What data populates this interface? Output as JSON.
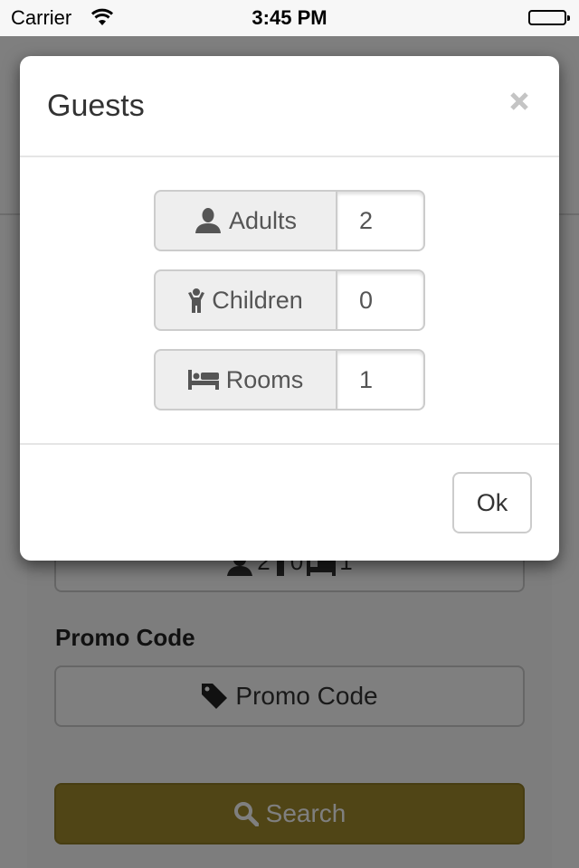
{
  "status_bar": {
    "carrier": "Carrier",
    "time": "3:45 PM"
  },
  "modal": {
    "title": "Guests",
    "close_icon": "close-icon",
    "fields": [
      {
        "label": "Adults",
        "icon": "user-icon",
        "value": "2"
      },
      {
        "label": "Children",
        "icon": "child-icon",
        "value": "0"
      },
      {
        "label": "Rooms",
        "icon": "bed-icon",
        "value": "1"
      }
    ],
    "ok_label": "Ok"
  },
  "background": {
    "guests_summary": {
      "adults": "2",
      "children": "0",
      "rooms": "1"
    },
    "promo_label": "Promo Code",
    "promo_button": "Promo Code",
    "search_button": "Search",
    "accent_color": "#a08a2c"
  }
}
